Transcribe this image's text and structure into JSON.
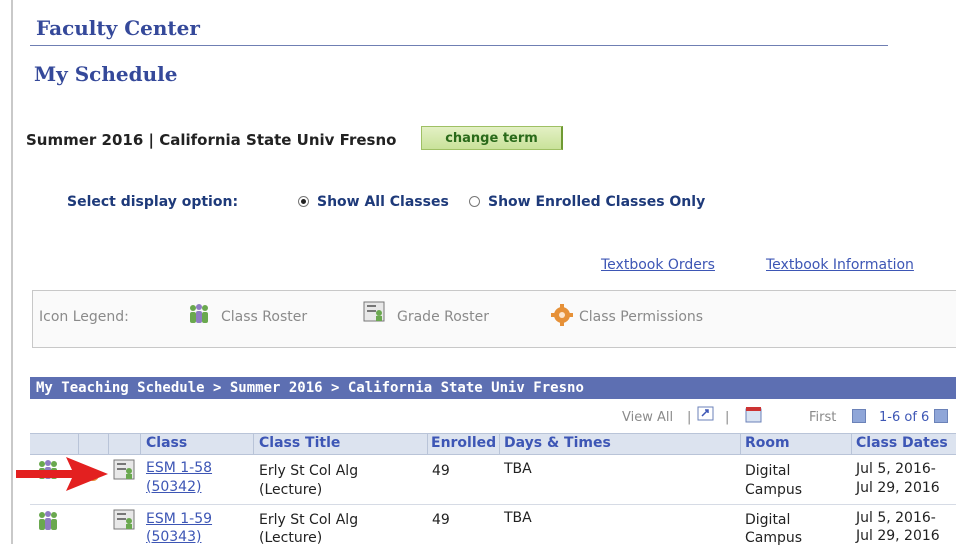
{
  "header": {
    "app_title": "Faculty Center",
    "page_title": "My Schedule"
  },
  "term": {
    "text": "Summer 2016 | California State Univ  Fresno",
    "change_label": "change term"
  },
  "display": {
    "label": "Select display option:",
    "option_all": "Show All Classes",
    "option_enrolled": "Show Enrolled Classes Only",
    "selected": "Show All Classes"
  },
  "links": {
    "textbook_orders": "Textbook Orders",
    "textbook_information": "Textbook Information"
  },
  "legend": {
    "label": "Icon Legend:",
    "class_roster": "Class Roster",
    "grade_roster": "Grade Roster",
    "class_permissions": "Class Permissions"
  },
  "schedule": {
    "header": "My Teaching Schedule > Summer 2016 > California State Univ Fresno",
    "view_all": "View All",
    "first": "First",
    "range": "1-6 of 6",
    "columns": [
      "Class",
      "Class Title",
      "Enrolled",
      "Days & Times",
      "Room",
      "Class Dates"
    ],
    "rows": [
      {
        "class_line1": "ESM 1-58",
        "class_line2": "(50342)",
        "title_line1": "Erly St Col Alg",
        "title_line2": "(Lecture)",
        "enrolled": "49",
        "days_times": "TBA",
        "room_line1": "Digital",
        "room_line2": "Campus",
        "dates_line1": "Jul 5, 2016-",
        "dates_line2": "Jul 29, 2016"
      },
      {
        "class_line1": "ESM 1-59",
        "class_line2": "(50343)",
        "title_line1": "Erly St Col Alg",
        "title_line2": "(Lecture)",
        "enrolled": "49",
        "days_times": "TBA",
        "room_line1": "Digital",
        "room_line2": "Campus",
        "dates_line1": "Jul 5, 2016-",
        "dates_line2": "Jul 29, 2016"
      }
    ]
  },
  "colors": {
    "title_blue": "#35499a",
    "header_bar": "#5d6fb2",
    "link_blue": "#3d56b5",
    "button_green": "#c9e29a",
    "arrow_red": "#e32020"
  }
}
